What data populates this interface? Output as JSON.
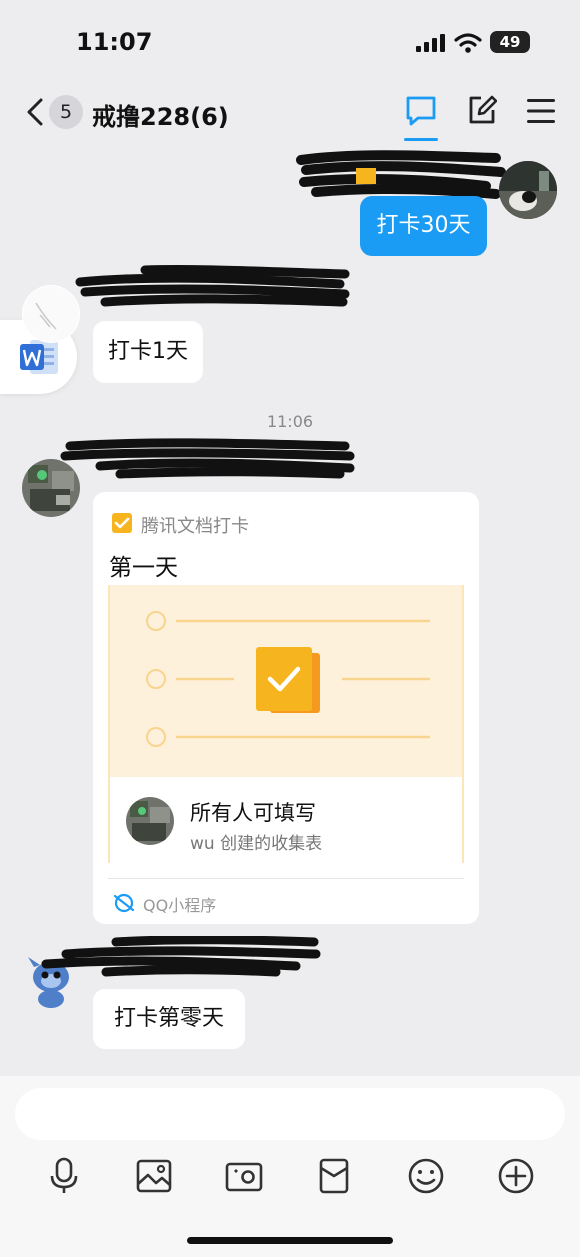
{
  "status_bar": {
    "time": "11:07",
    "battery": "49"
  },
  "header": {
    "unread_count": "5",
    "title": "戒撸228(6)"
  },
  "messages": [
    {
      "text": "打卡30天"
    },
    {
      "text": "打卡1天"
    },
    {
      "text": "打卡第零天"
    }
  ],
  "timestamp": "11:06",
  "card": {
    "source": "腾讯文档打卡",
    "title": "第一天",
    "footer_title": "所有人可填写",
    "footer_sub": "wu 创建的收集表",
    "mini_program": "QQ小程序"
  },
  "input": {
    "placeholder": ""
  },
  "colors": {
    "accent": "#1a9cf5",
    "card_bg": "#fdf1db",
    "icon_yellow": "#f6b51e"
  }
}
